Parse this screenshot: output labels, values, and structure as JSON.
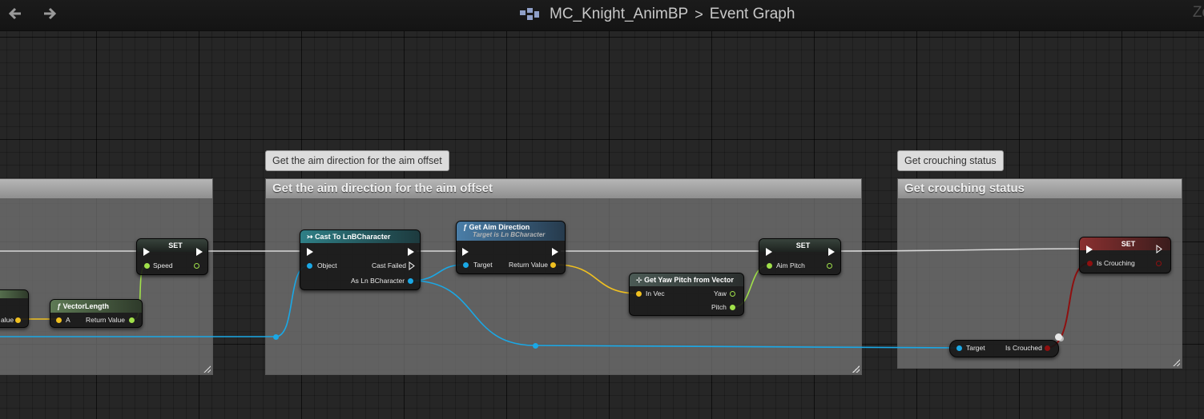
{
  "toolbar": {
    "back_icon": "arrow-left-icon",
    "forward_icon": "arrow-right-icon",
    "blueprint_icon": "blueprint-icon",
    "breadcrumb": {
      "blueprint": "MC_Knight_AnimBP",
      "separator": ">",
      "graph": "Event Graph"
    },
    "zoom_partial": "Zo"
  },
  "comments": {
    "left_box": {
      "title": ""
    },
    "aim": {
      "bubble": "Get the aim direction for the aim offset",
      "title": "Get the aim direction for the aim offset"
    },
    "crouch": {
      "bubble": "Get crouching status",
      "title": "Get crouching status"
    }
  },
  "nodes": {
    "partial_node": {
      "pin_label": "alue"
    },
    "vector_length": {
      "icon": "function-icon",
      "title": "VectorLength",
      "in": "A",
      "out": "Return Value"
    },
    "set_speed": {
      "title": "SET",
      "var": "Speed"
    },
    "cast": {
      "icon": "cast-icon",
      "title": "Cast To LnBCharacter",
      "in": "Object",
      "out_exec": "Cast Failed",
      "out": "As Ln BCharacter"
    },
    "get_aim": {
      "icon": "function-icon",
      "title": "Get Aim Direction",
      "subtitle": "Target is Ln BCharacter",
      "in": "Target",
      "out": "Return Value"
    },
    "yaw_pitch": {
      "icon": "function-icon",
      "title": "Get Yaw Pitch from Vector",
      "in": "In Vec",
      "out1": "Yaw",
      "out2": "Pitch"
    },
    "set_aim_pitch": {
      "title": "SET",
      "var": "Aim Pitch"
    },
    "set_crouching": {
      "title": "SET",
      "var": "Is Crouching"
    },
    "get_crouched": {
      "in": "Target",
      "out": "Is Crouched"
    }
  },
  "colors": {
    "exec": "#ffffff",
    "object": "#1aa8e6",
    "float": "#a0e04a",
    "vector": "#f0c020",
    "bool": "#8e1010"
  }
}
